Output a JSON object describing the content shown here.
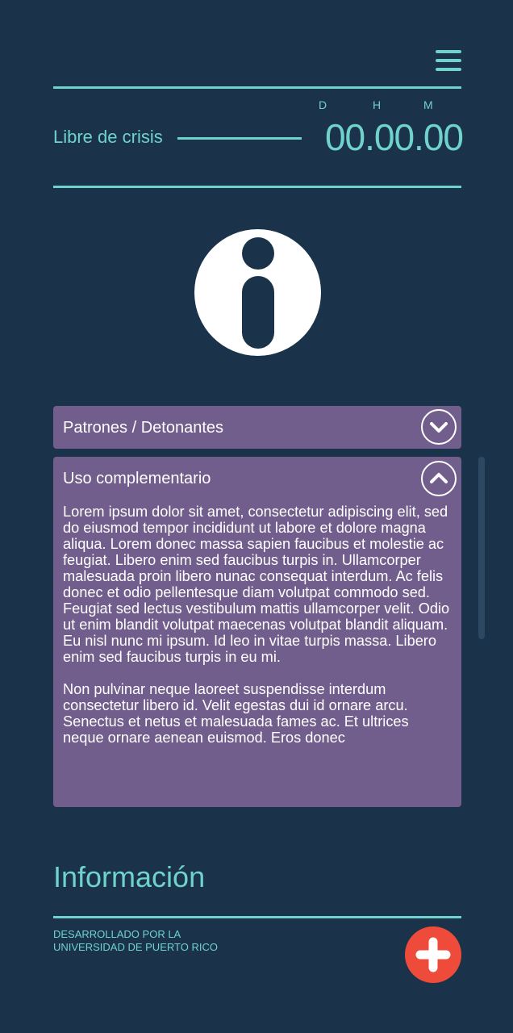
{
  "header": {
    "menu_icon": "hamburger-menu-icon"
  },
  "timer": {
    "label": "Libre de crisis",
    "unit_days": "D",
    "unit_hours": "H",
    "unit_minutes": "M",
    "value": "00.00.00"
  },
  "info_icon": "info-icon",
  "panels": [
    {
      "title": "Patrones / Detonantes",
      "expanded": false,
      "toggle_icon": "chevron-down-icon"
    },
    {
      "title": "Uso complementario",
      "expanded": true,
      "toggle_icon": "chevron-up-icon",
      "paragraphs": [
        "Lorem ipsum dolor sit amet, consectetur adipiscing elit, sed do eiusmod tempor incididunt ut labore et dolore magna aliqua. Lorem donec massa sapien faucibus et molestie ac feugiat. Libero enim sed faucibus turpis in. Ullamcorper malesuada proin libero nunac consequat interdum. Ac felis donec et odio pellentesque diam volutpat commodo sed. Feugiat sed lectus vestibulum mattis ullamcorper velit. Odio ut enim blandit volutpat maecenas volutpat blandit aliquam. Eu nisl nunc mi ipsum. Id leo in vitae turpis massa. Libero enim sed faucibus turpis in eu mi.",
        "Non pulvinar neque laoreet suspendisse interdum consectetur libero id. Velit egestas dui id ornare arcu. Senectus et netus et malesuada fames ac. Et ultrices neque ornare aenean euismod. Eros donec"
      ]
    }
  ],
  "footer": {
    "heading": "Información",
    "credit_line1": "DESARROLLADO POR LA",
    "credit_line2": "UNIVERSIDAD DE PUERTO RICO",
    "fab_icon": "plus-icon"
  },
  "colors": {
    "background": "#1a334a",
    "accent": "#6fd3cb",
    "panel": "#725e8c",
    "fab": "#ef4b3a"
  }
}
